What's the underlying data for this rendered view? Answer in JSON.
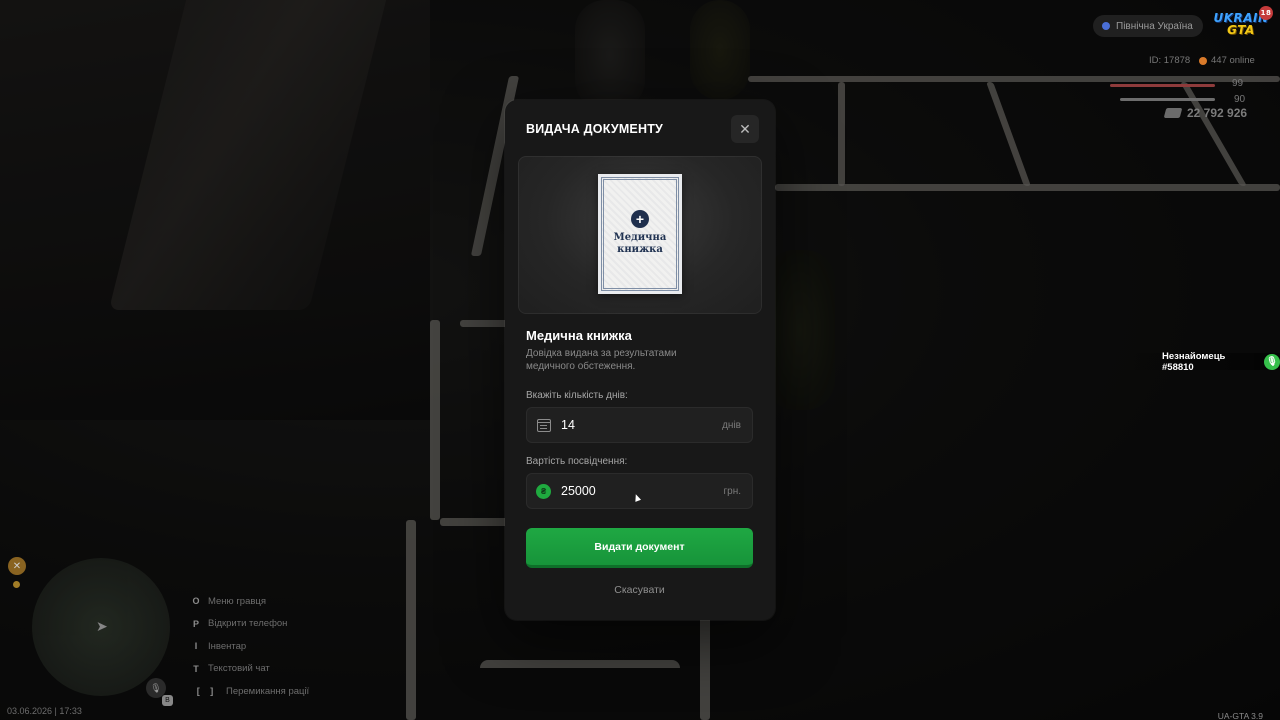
{
  "hud": {
    "region": "Північна Україна",
    "logo_top": "UKRAIN",
    "logo_bottom": "GTA",
    "logo_badge": "18",
    "server_id": "ID: 17878",
    "online": "447 online",
    "health": "99",
    "armor": "90",
    "money": "22 792 926",
    "player_tag": "Незнайомець #58810",
    "datetime": "03.06.2026 | 17:33",
    "version": "UA-GTA 3.9",
    "hotkeys": [
      {
        "key": "O",
        "label": "Меню гравця"
      },
      {
        "key": "P",
        "label": "Відкрити телефон"
      },
      {
        "key": "I",
        "label": "Інвентар"
      },
      {
        "key": "T",
        "label": "Текстовий чат"
      },
      {
        "key": "[ ]",
        "label": "Перемикання рації"
      }
    ],
    "mic_key": "B"
  },
  "modal": {
    "title": "ВИДАЧА ДОКУМЕНТУ",
    "close_symbol": "✕",
    "preview_doc_text": "Медична книжка",
    "doc_name": "Медична книжка",
    "doc_description": "Довідка видана за результатами медичного обстеження.",
    "days_label": "Вкажіть кількість днів:",
    "days_value": "14",
    "days_unit": "днів",
    "price_label": "Вартість посвідчення:",
    "price_value": "25000",
    "price_unit": "грн.",
    "currency_symbol": "₴",
    "issue_button": "Видати документ",
    "cancel_button": "Скасувати"
  },
  "colors": {
    "accent_green": "#1fa843",
    "modal_bg": "#181818"
  }
}
